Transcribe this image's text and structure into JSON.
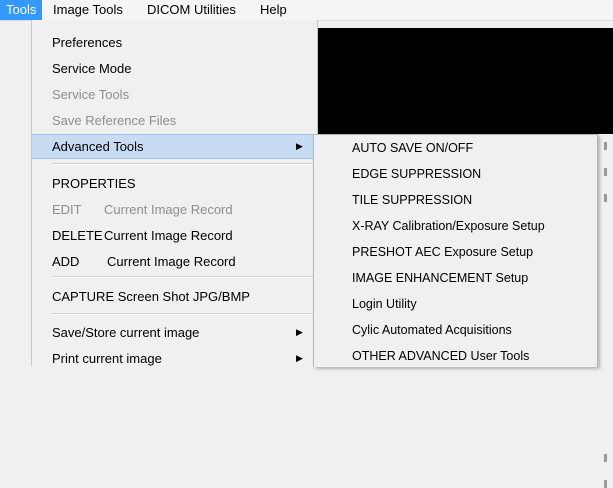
{
  "menubar": {
    "items": [
      "Tools",
      "Image Tools",
      "DICOM Utilities",
      "Help"
    ],
    "active_index": 0,
    "active_color": "#3399ff"
  },
  "tools_menu": {
    "preferences": "Preferences",
    "service_mode": "Service Mode",
    "service_tools": "Service Tools",
    "save_reference_files": "Save Reference Files",
    "advanced_tools": "Advanced Tools",
    "properties": "PROPERTIES",
    "edit_prefix": "EDIT",
    "edit_suffix": "Current Image Record",
    "delete_prefix": "DELETE",
    "delete_suffix": "Current Image Record",
    "add_prefix": "ADD",
    "add_suffix": "Current Image Record",
    "capture": "CAPTURE Screen Shot JPG/BMP",
    "save_store": "Save/Store current image",
    "print": "Print current image",
    "submenu_arrow": "▶",
    "highlight_color": "#c7dcf3"
  },
  "advanced_submenu": {
    "items": [
      "AUTO SAVE ON/OFF",
      "EDGE SUPPRESSION",
      "TILE SUPPRESSION",
      "X-RAY Calibration/Exposure Setup",
      "PRESHOT AEC Exposure Setup",
      "IMAGE ENHANCEMENT Setup",
      "Login Utility",
      "Cylic Automated Acquisitions",
      "OTHER ADVANCED User Tools"
    ]
  }
}
